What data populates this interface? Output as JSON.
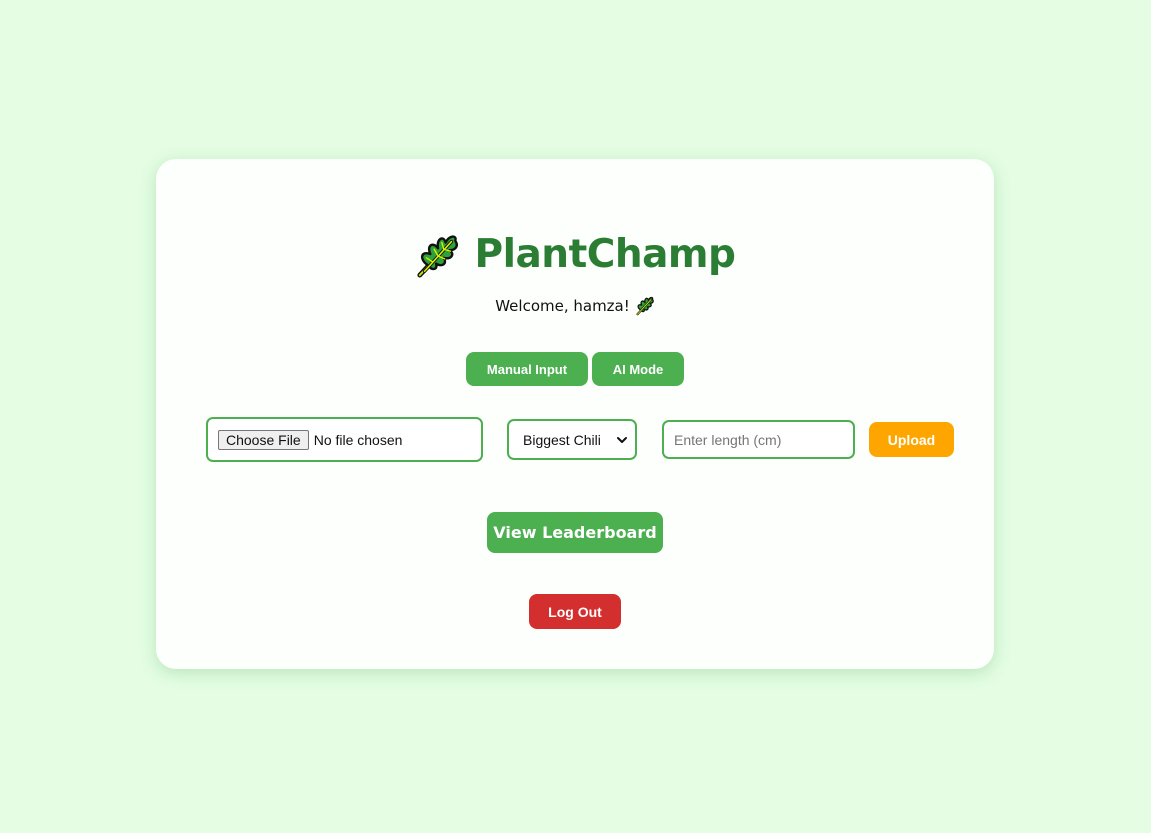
{
  "app": {
    "title": "PlantChamp",
    "logo_icon": "leaf-icon"
  },
  "welcome": {
    "text": "Welcome, hamza!",
    "icon": "leaf-icon"
  },
  "modes": {
    "manual_label": "Manual Input",
    "ai_label": "AI Mode"
  },
  "upload_form": {
    "choose_file_label": "Choose File",
    "file_status": "No file chosen",
    "category_selected": "Biggest Chili",
    "length_placeholder": "Enter length (cm)",
    "length_value": "",
    "upload_label": "Upload"
  },
  "actions": {
    "leaderboard_label": "View Leaderboard",
    "logout_label": "Log Out"
  },
  "colors": {
    "background": "#e4fde3",
    "card": "#fdfffc",
    "title": "#2a7d33",
    "primary_green": "#4caf50",
    "upload_orange": "#ffa500",
    "logout_red": "#d32f2f"
  }
}
